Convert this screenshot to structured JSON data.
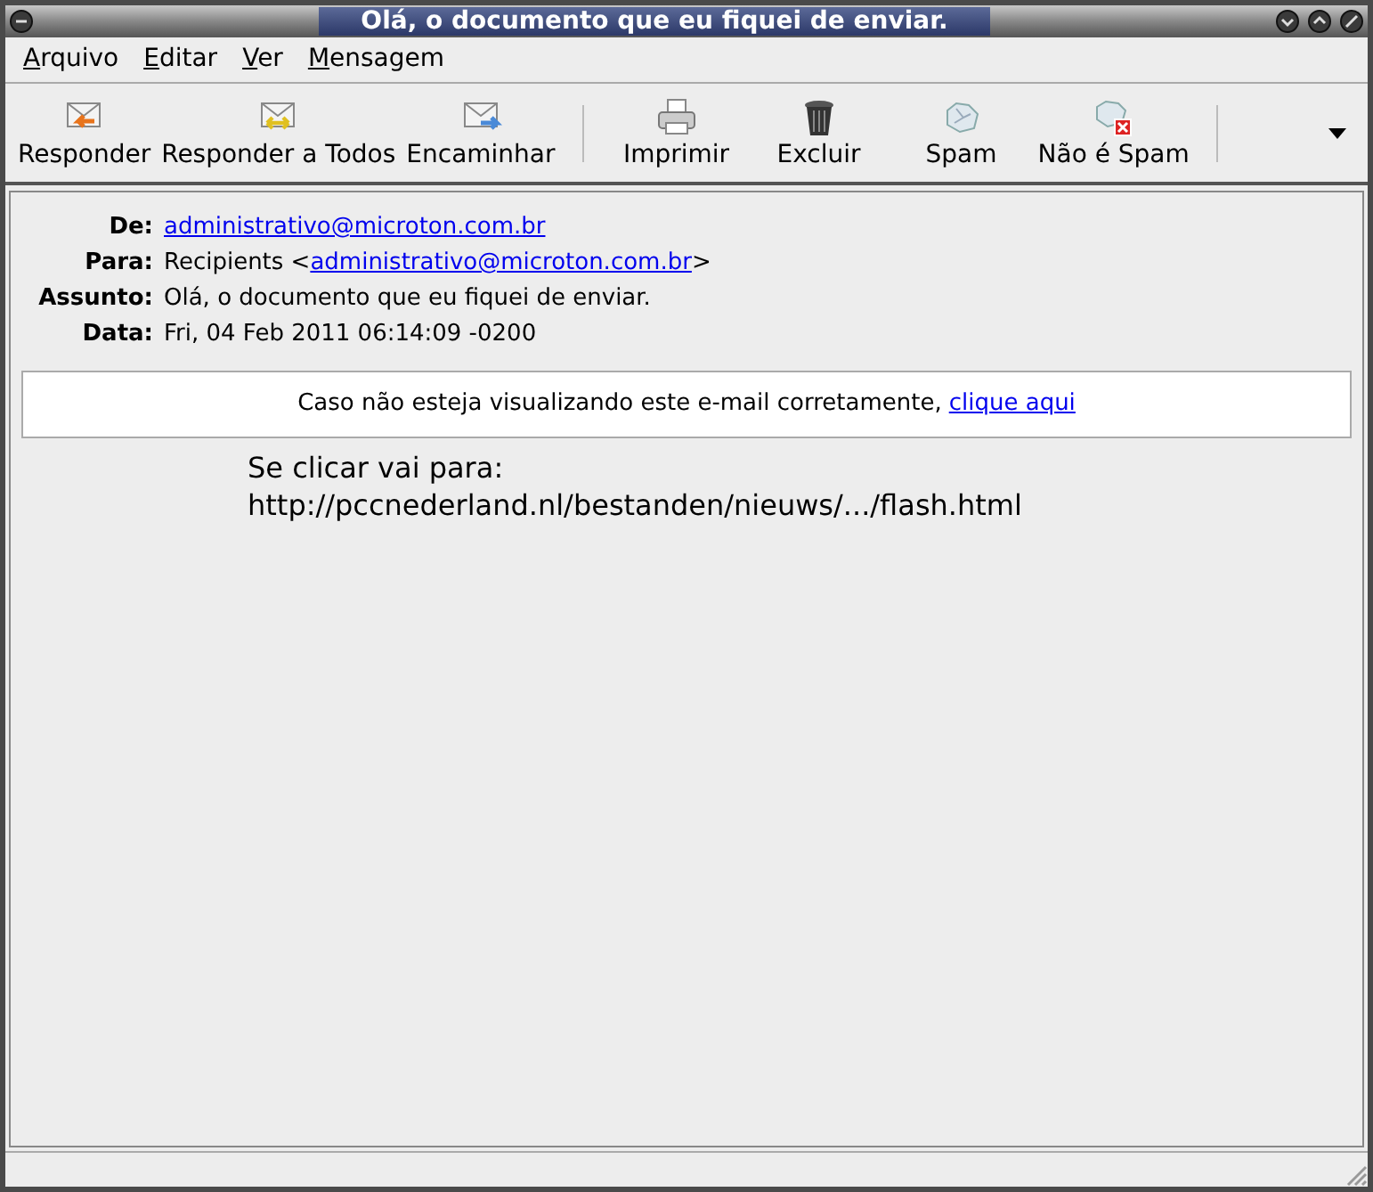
{
  "window": {
    "title": "Olá, o documento que eu fiquei de enviar."
  },
  "menu": [
    "Arquivo",
    "Editar",
    "Ver",
    "Mensagem"
  ],
  "toolbar": [
    {
      "label": "Responder",
      "kind": "reply"
    },
    {
      "label": "Responder a Todos",
      "kind": "reply_all"
    },
    {
      "label": "Encaminhar",
      "kind": "forward"
    },
    {
      "kind": "separator"
    },
    {
      "label": "Imprimir",
      "kind": "print"
    },
    {
      "label": "Excluir",
      "kind": "delete"
    },
    {
      "label": "Spam",
      "kind": "spam"
    },
    {
      "label": "Não é Spam",
      "kind": "not_spam"
    },
    {
      "kind": "separator"
    }
  ],
  "headers": [
    {
      "label": "De:",
      "parts": [
        {
          "text": "administrativo@microton.com.br",
          "link": true
        }
      ]
    },
    {
      "label": "Para:",
      "parts": [
        {
          "text": "Recipients <",
          "link": false
        },
        {
          "text": "administrativo@microton.com.br",
          "link": true
        },
        {
          "text": ">",
          "link": false
        }
      ]
    },
    {
      "label": "Assunto:",
      "parts": [
        {
          "text": "Olá, o documento que eu fiquei de enviar.",
          "link": false
        }
      ]
    },
    {
      "label": "Data:",
      "parts": [
        {
          "text": "Fri, 04 Feb 2011 06:14:09 -0200",
          "link": false
        }
      ]
    }
  ],
  "notice": {
    "text": "Caso não esteja visualizando este e-mail corretamente,",
    "link": "clique aqui"
  },
  "link_hint": [
    "Se clicar vai para:",
    "http://pccnederland.nl/bestanden/nieuws/.../flash.html"
  ]
}
